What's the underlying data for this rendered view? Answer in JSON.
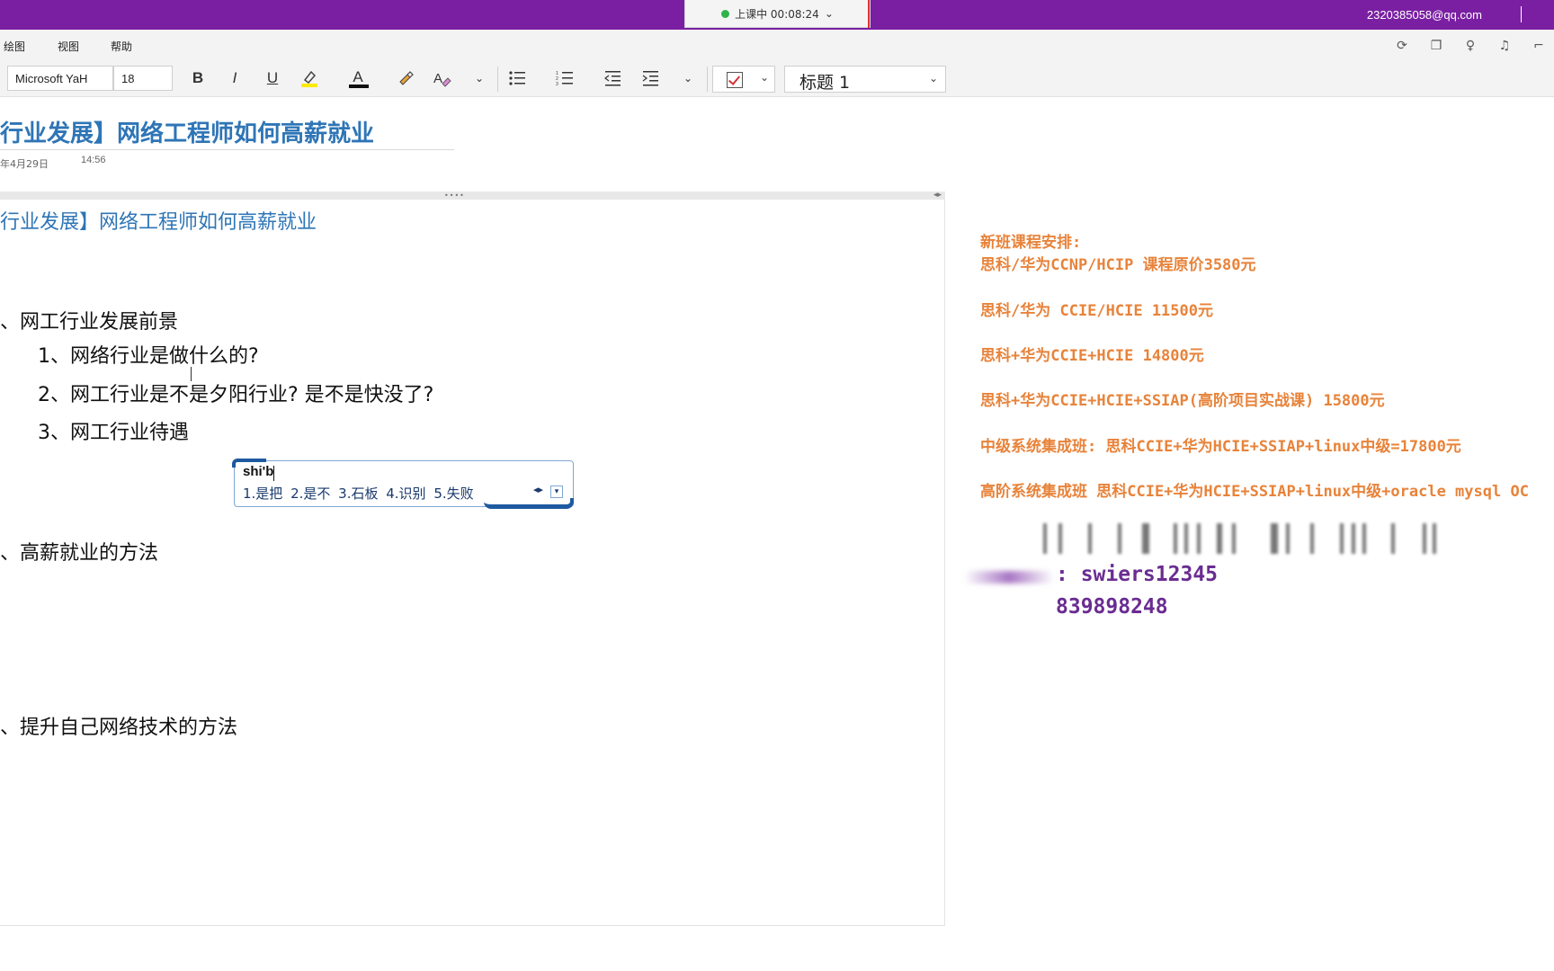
{
  "titlebar": {
    "meeting_status": "上课中 00:08:24",
    "meeting_chevron": "⌄",
    "account_email": "2320385058@qq.com"
  },
  "menu": {
    "items": [
      "绘图",
      "视图",
      "帮助"
    ]
  },
  "toolbar": {
    "font_name": "Microsoft YaH",
    "font_size": "18",
    "bold": "B",
    "italic": "I",
    "underline": "U",
    "font_color": "A",
    "style_value": "标题 1"
  },
  "page": {
    "title": "行业发展】网络工程师如何高薪就业",
    "date": "年4月29日",
    "time": "14:56"
  },
  "note": {
    "heading": "行业发展】网络工程师如何高薪就业",
    "section1": "、网工行业发展前景",
    "sub_items": [
      "1、网络行业是做什么的?",
      "2、网工行业是不是夕阳行业? 是不是快没了?",
      "3、网工行业待遇"
    ],
    "section2": "、高薪就业的方法",
    "section3": "、提升自己网络技术的方法"
  },
  "ime": {
    "composition": "shi'b",
    "candidates": "1.是把  2.是不  3.石板  4.识别  5.失败"
  },
  "courses": {
    "heading": "新班课程安排:",
    "lines": [
      "思科/华为CCNP/HCIP  课程原价3580元",
      "思科/华为 CCIE/HCIE  11500元",
      "思科+华为CCIE+HCIE 14800元",
      "思科+华为CCIE+HCIE+SSIAP(高阶项目实战课) 15800元",
      "中级系统集成班: 思科CCIE+华为HCIE+SSIAP+linux中级=17800元",
      "高阶系统集成班 思科CCIE+华为HCIE+SSIAP+linux中级+oracle mysql OC"
    ],
    "contact_1": ": swiers12345",
    "contact_2": "839898248"
  },
  "colors": {
    "titlebar": "#7a1fa2",
    "heading_blue": "#2e75b6",
    "course_orange": "#e8833a",
    "contact_purple": "#6a2c91"
  }
}
